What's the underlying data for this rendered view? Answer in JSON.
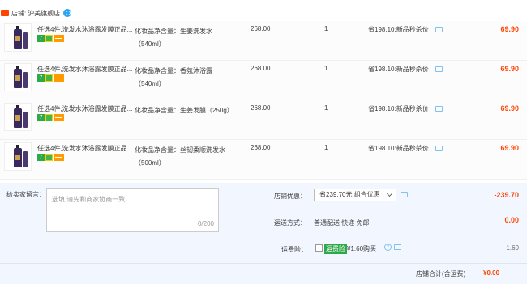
{
  "shop": {
    "prefix": "店铺:",
    "name": "沪美旗舰店"
  },
  "items": [
    {
      "title": "任选4件,洗发水沐浴露发膜正品...",
      "sku": "化妆品净含量：生姜洗发水（540ml）",
      "price": "268.00",
      "qty": "1",
      "promo": "省198.10:新品秒杀价",
      "sum": "69.90"
    },
    {
      "title": "任选4件,洗发水沐浴露发膜正品...",
      "sku": "化妆品净含量：香氛沐浴露（540ml）",
      "price": "268.00",
      "qty": "1",
      "promo": "省198.10:新品秒杀价",
      "sum": "69.90"
    },
    {
      "title": "任选4件,洗发水沐浴露发膜正品...",
      "sku": "化妆品净含量：生姜发膜（250g）",
      "price": "268.00",
      "qty": "1",
      "promo": "省198.10:新品秒杀价",
      "sum": "69.90"
    },
    {
      "title": "任选4件,洗发水沐浴露发膜正品...",
      "sku": "化妆品净含量：丝韧柔顺洗发水（500ml）",
      "price": "268.00",
      "qty": "1",
      "promo": "省198.10:新品秒杀价",
      "sum": "69.90"
    }
  ],
  "memo": {
    "label": "给卖家留言：",
    "placeholder": "选填,请先和商家协商一致",
    "count": "0/200"
  },
  "coupon": {
    "label": "店铺优惠：",
    "selected": "省239.70元:组合优惠",
    "amount": "-239.70"
  },
  "shipping": {
    "label": "运送方式：",
    "value": "普通配送 快递 免邮",
    "fee": "0.00"
  },
  "insurance": {
    "label": "运费险：",
    "badge": "运费险",
    "price": "¥1.60购买",
    "fee": "1.60"
  },
  "total": {
    "label": "店铺合计(含运费)",
    "amount": "¥0.00"
  },
  "colors": {
    "accent": "#ff4400",
    "link": "#29a3ef",
    "panel": "#f2f7ff"
  }
}
